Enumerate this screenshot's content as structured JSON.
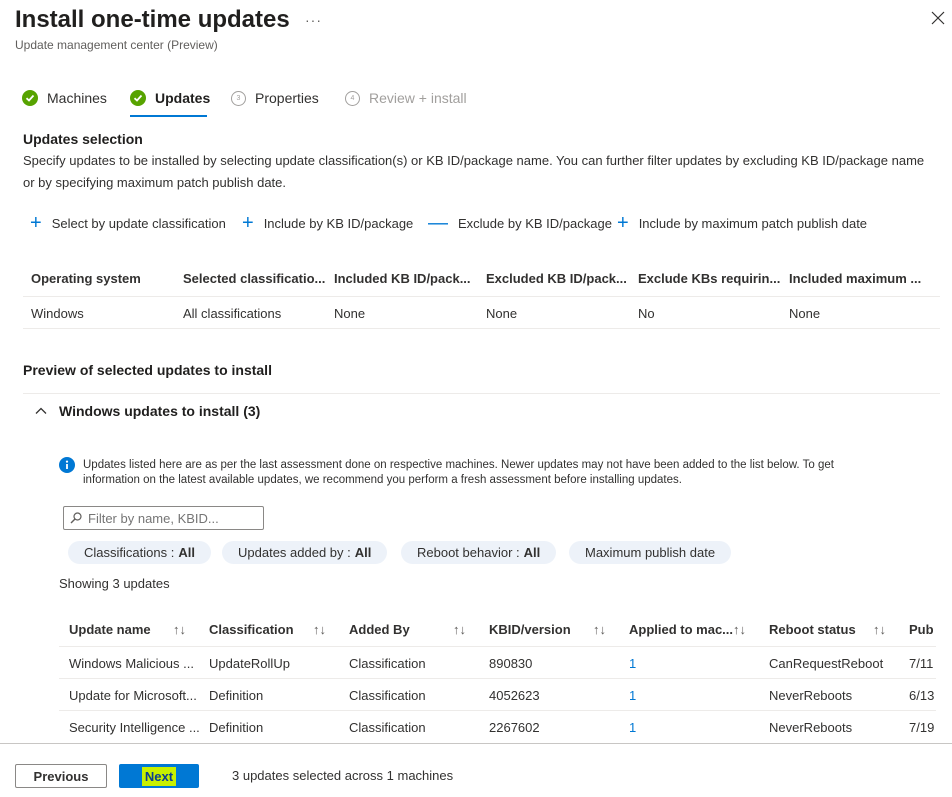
{
  "header": {
    "title": "Install one-time updates",
    "more": "···",
    "subtitle": "Update management center (Preview)"
  },
  "steps": [
    {
      "label": "Machines",
      "state": "done"
    },
    {
      "label": "Updates",
      "state": "current"
    },
    {
      "label": "Properties",
      "number": "3",
      "state": "pending"
    },
    {
      "label": "Review + install",
      "number": "4",
      "state": "disabled"
    }
  ],
  "selection": {
    "heading": "Updates selection",
    "description": "Specify updates to be installed by selecting update classification(s) or KB ID/package name. You can further filter updates by excluding KB ID/package name or by specifying maximum patch publish date.",
    "actions": [
      {
        "label": "Select by update classification",
        "icon": "plus-icon"
      },
      {
        "label": "Include by KB ID/package",
        "icon": "plus-icon"
      },
      {
        "label": "Exclude by KB ID/package",
        "icon": "minus-icon"
      },
      {
        "label": "Include by maximum patch publish date",
        "icon": "plus-icon"
      }
    ],
    "columns": [
      "Operating system",
      "Selected classificatio...",
      "Included KB ID/pack...",
      "Excluded KB ID/pack...",
      "Exclude KBs requirin...",
      "Included maximum ..."
    ],
    "row": [
      "Windows",
      "All classifications",
      "None",
      "None",
      "No",
      "None"
    ]
  },
  "preview": {
    "heading": "Preview of selected updates to install",
    "group_label": "Windows updates to install (3)",
    "info": "Updates listed here are as per the last assessment done on respective machines. Newer updates may not have been added to the list below. To get information on the latest available updates, we recommend you perform a fresh assessment before installing updates.",
    "filter_placeholder": "Filter by name, KBID...",
    "chips": [
      {
        "label": "Classifications : ",
        "value": "All"
      },
      {
        "label": "Updates added by : ",
        "value": "All"
      },
      {
        "label": "Reboot behavior : ",
        "value": "All"
      },
      {
        "label": "Maximum publish date",
        "value": ""
      }
    ],
    "showing": "Showing 3 updates",
    "sort_glyph": "↑↓",
    "columns": [
      "Update name",
      "Classification",
      "Added By",
      "KBID/version",
      "Applied to mac...",
      "Reboot status",
      "Pub"
    ],
    "rows": [
      [
        "Windows Malicious ...",
        "UpdateRollUp",
        "Classification",
        "890830",
        "1",
        "CanRequestReboot",
        "7/11"
      ],
      [
        "Update for Microsoft...",
        "Definition",
        "Classification",
        "4052623",
        "1",
        "NeverReboots",
        "6/13"
      ],
      [
        "Security Intelligence ...",
        "Definition",
        "Classification",
        "2267602",
        "1",
        "NeverReboots",
        "7/19"
      ]
    ]
  },
  "footer": {
    "previous": "Previous",
    "next": "Next",
    "status": "3 updates selected across 1 machines"
  },
  "colors": {
    "accent": "#0078d4",
    "success": "#57a300",
    "highlight": "#c8f000"
  }
}
